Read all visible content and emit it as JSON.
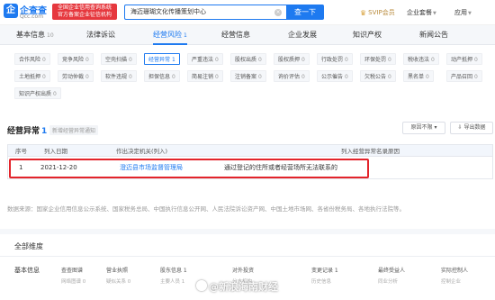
{
  "header": {
    "brand": "企查查",
    "brand_sub": "Qcc.com",
    "slogan_line1": "全国企业信用查询系统",
    "slogan_line2": "官方备案企业征信机构",
    "search_value": "海迈珊瑚文化传播策划中心",
    "search_button": "查一下",
    "svip_label": "SVIP会员",
    "menu_enterprise": "企业套餐",
    "menu_app": "应用"
  },
  "main_tabs": [
    {
      "label": "基本信息",
      "count": "10"
    },
    {
      "label": "法律诉讼",
      "count": ""
    },
    {
      "label": "经营风险",
      "count": "1"
    },
    {
      "label": "经营信息",
      "count": ""
    },
    {
      "label": "企业发展",
      "count": ""
    },
    {
      "label": "知识产权",
      "count": ""
    },
    {
      "label": "新闻公告",
      "count": ""
    }
  ],
  "sub_tabs": [
    {
      "label": "合作风险",
      "count": "0"
    },
    {
      "label": "竞争风险",
      "count": "0"
    },
    {
      "label": "空壳扫描",
      "count": "0"
    },
    {
      "label": "经营异常",
      "count": "1"
    },
    {
      "label": "严重违法",
      "count": "0"
    },
    {
      "label": "股权出质",
      "count": "0"
    },
    {
      "label": "股权质押",
      "count": "0"
    },
    {
      "label": "行政处罚",
      "count": "0"
    },
    {
      "label": "环保处罚",
      "count": "0"
    },
    {
      "label": "税收违法",
      "count": "0"
    },
    {
      "label": "动产抵押",
      "count": "0"
    },
    {
      "label": "土地抵押",
      "count": "0"
    },
    {
      "label": "劳动仲裁",
      "count": "0"
    },
    {
      "label": "软件违规",
      "count": "0"
    },
    {
      "label": "担保信息",
      "count": "0"
    },
    {
      "label": "简易注销",
      "count": "0"
    },
    {
      "label": "注销备案",
      "count": "0"
    },
    {
      "label": "询价评估",
      "count": "0"
    },
    {
      "label": "公示催告",
      "count": "0"
    },
    {
      "label": "欠税公告",
      "count": "0"
    },
    {
      "label": "黑名单",
      "count": "0"
    },
    {
      "label": "产品召回",
      "count": "0"
    },
    {
      "label": "知识产权出质",
      "count": "0"
    }
  ],
  "section": {
    "title": "经营异常",
    "count": "1",
    "link": "新增经营异常通知",
    "dropdown": "原因不限",
    "export": "导出数据"
  },
  "table": {
    "headers": [
      "序号",
      "列入日期",
      "作出决定机关(列入)",
      "列入经营异常名录原因"
    ],
    "rows": [
      {
        "index": "1",
        "date": "2021-12-20",
        "authority": "澄迈县市场监督管理局",
        "reason": "通过登记的住所或者经营场所无法联系的"
      }
    ]
  },
  "source_text": "数据来源：国家企业信用信息公示系统、国家税务总局、中国执行信息公开网、人民法院诉讼资产网、中国土地市场网、各省份税务局、各地执行法院等。",
  "dimension_title": "全部维度",
  "bottom": {
    "row_label": "基本信息",
    "cols": [
      {
        "main": "查查图谱",
        "sub": "网络图谱 0"
      },
      {
        "main": "营业执照",
        "sub": "疑似关系 0"
      },
      {
        "main": "股东信息 1",
        "sub": "主要人员 1"
      },
      {
        "main": "对外投资",
        "sub": "分支机构"
      },
      {
        "main": "变更记录 1",
        "sub": "历史信息"
      },
      {
        "main": "最终受益人",
        "sub": "同业分析"
      },
      {
        "main": "实际控制人",
        "sub": "控制企业"
      }
    ]
  },
  "watermark": "@新浪海南财经"
}
